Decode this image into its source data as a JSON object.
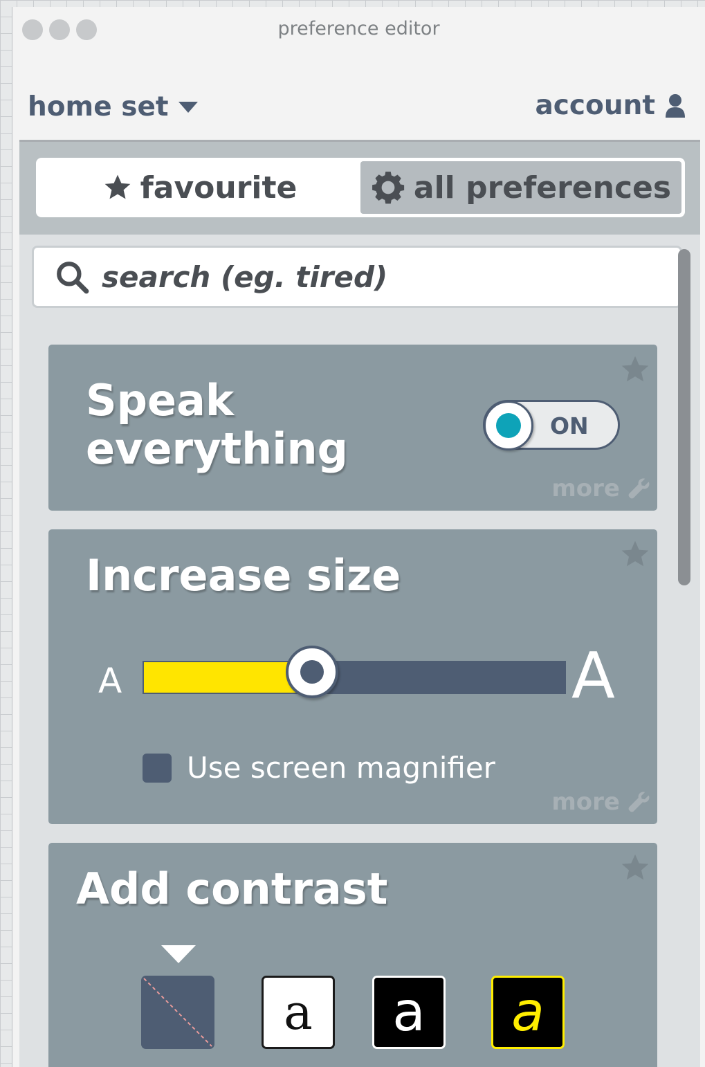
{
  "window": {
    "title": "preference editor"
  },
  "header": {
    "set_label": "home set",
    "account_label": "account"
  },
  "tabs": [
    {
      "label": "favourite",
      "icon": "star-icon",
      "active": false
    },
    {
      "label": "all preferences",
      "icon": "gear-icon",
      "active": true
    }
  ],
  "search": {
    "placeholder": "search (eg. tired)",
    "value": ""
  },
  "cards": {
    "speak": {
      "title_line1": "Speak",
      "title_line2": "everything",
      "toggle_label": "ON",
      "toggle_on": true,
      "more_label": "more"
    },
    "size": {
      "title": "Increase size",
      "small_glyph": "A",
      "large_glyph": "A",
      "slider_value": 0.4,
      "checkbox_label": "Use screen magnifier",
      "more_label": "more"
    },
    "contrast": {
      "title": "Add contrast",
      "swatches": [
        {
          "name": "no-contrast",
          "glyph": ""
        },
        {
          "name": "black-on-white",
          "glyph": "a"
        },
        {
          "name": "white-on-black",
          "glyph": "a"
        },
        {
          "name": "yellow-on-black",
          "glyph": "a"
        }
      ]
    }
  },
  "colors": {
    "accent_dark": "#4e5d73",
    "card_bg": "#8b9aa1",
    "toggle_dot": "#0ea3b8",
    "slider_fill": "#ffe500",
    "contrast_yellow": "#ffee00"
  }
}
